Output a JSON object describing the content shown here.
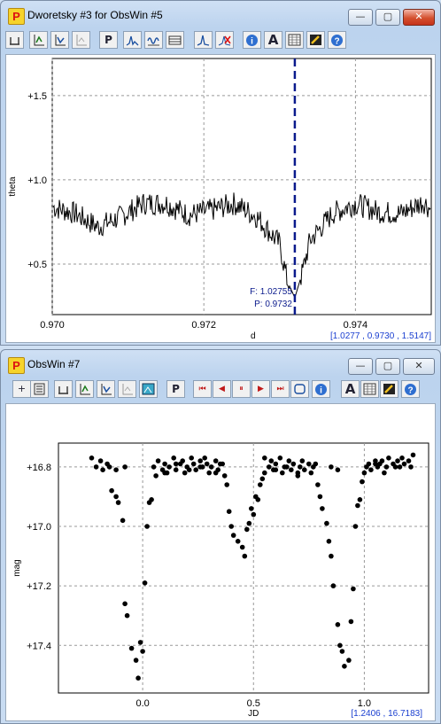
{
  "window1": {
    "title": "Dworetsky #3 for ObsWin #5",
    "app_icon_letter": "P",
    "controls": {
      "minimize": "—",
      "maximize": "▢",
      "close": "✕"
    },
    "toolbar": [
      {
        "icon": "save-icon"
      },
      {
        "icon": "zoom-in-icon"
      },
      {
        "icon": "zoom-out-icon"
      },
      {
        "icon": "zoom-disabled-icon"
      },
      {
        "icon": "period-icon",
        "label": "P"
      },
      {
        "icon": "periodogram-icon"
      },
      {
        "icon": "wave-icon"
      },
      {
        "icon": "table-icon"
      },
      {
        "icon": "peak-icon"
      },
      {
        "icon": "remove-peak-icon"
      },
      {
        "icon": "info-icon"
      },
      {
        "icon": "font-icon",
        "label": "A"
      },
      {
        "icon": "grid-icon"
      },
      {
        "icon": "edit-icon"
      },
      {
        "icon": "help-icon"
      }
    ],
    "status": "[1.0277 , 0.9730 , 1.5147]",
    "annotation_freq": "F: 1.02755",
    "annotation_period": "P: 0.9732",
    "chart_data": {
      "type": "line",
      "xlabel": "d",
      "ylabel": "theta",
      "xlim": [
        0.97,
        0.975
      ],
      "ylim": [
        0.2,
        1.72
      ],
      "xticks": [
        0.97,
        0.972,
        0.974
      ],
      "xtick_labels": [
        "0.970",
        "0.972",
        "0.974"
      ],
      "yticks": [
        0.5,
        1.0,
        1.5
      ],
      "ytick_labels": [
        "+0.5",
        "+1.0",
        "+1.5"
      ],
      "grid": true,
      "marker_line_x": 0.9732,
      "x": [
        0.97,
        0.9703,
        0.9706,
        0.9709,
        0.9712,
        0.9715,
        0.9718,
        0.9721,
        0.9724,
        0.9727,
        0.973,
        0.9731,
        0.9732,
        0.9733,
        0.9734,
        0.9737,
        0.974,
        0.9743,
        0.9746,
        0.9749,
        0.975
      ],
      "y": [
        0.84,
        0.8,
        0.72,
        0.78,
        0.86,
        0.86,
        0.79,
        0.82,
        0.86,
        0.78,
        0.62,
        0.4,
        0.3,
        0.45,
        0.64,
        0.8,
        0.86,
        0.81,
        0.8,
        0.87,
        0.82
      ]
    }
  },
  "window2": {
    "title": "ObsWin #7",
    "app_icon_letter": "P",
    "controls": {
      "minimize": "—",
      "maximize": "▢",
      "close": "✕"
    },
    "toolbar": [
      {
        "icon": "add-icon",
        "label": "+"
      },
      {
        "icon": "calc-icon"
      },
      {
        "icon": "save-icon"
      },
      {
        "icon": "zoom-in-icon"
      },
      {
        "icon": "zoom-out-icon"
      },
      {
        "icon": "zoom-disabled-icon"
      },
      {
        "icon": "image-icon"
      },
      {
        "icon": "period-icon",
        "label": "P"
      },
      {
        "icon": "first-icon",
        "label": "⏮"
      },
      {
        "icon": "prev-icon",
        "label": "◀"
      },
      {
        "icon": "pause-icon",
        "label": "⏸"
      },
      {
        "icon": "next-icon",
        "label": "▶"
      },
      {
        "icon": "last-icon",
        "label": "⏭"
      },
      {
        "icon": "loop-icon"
      },
      {
        "icon": "info-icon"
      },
      {
        "icon": "font-icon",
        "label": "A"
      },
      {
        "icon": "grid-icon"
      },
      {
        "icon": "edit-icon"
      },
      {
        "icon": "help-icon"
      }
    ],
    "status": "[1.2406 , 16.7183]",
    "chart_data": {
      "type": "scatter",
      "xlabel": "JD",
      "ylabel": "mag",
      "xlim": [
        -0.38,
        1.29
      ],
      "ylim": [
        17.56,
        16.72
      ],
      "xticks": [
        0.0,
        0.5,
        1.0
      ],
      "xtick_labels": [
        "0.0",
        "0.5",
        "1.0"
      ],
      "yticks": [
        16.8,
        17.0,
        17.2,
        17.4
      ],
      "ytick_labels": [
        "+16.8",
        "+17.0",
        "+17.2",
        "+17.4"
      ],
      "grid": true,
      "x": [
        -0.23,
        -0.21,
        -0.19,
        -0.18,
        -0.16,
        -0.14,
        -0.12,
        -0.11,
        -0.09,
        -0.08,
        -0.07,
        -0.05,
        -0.03,
        -0.02,
        -0.01,
        0.0,
        0.01,
        0.02,
        0.03,
        0.04,
        0.05,
        0.06,
        0.07,
        0.09,
        0.1,
        0.11,
        0.12,
        0.14,
        0.15,
        0.17,
        0.18,
        0.19,
        0.2,
        0.22,
        0.23,
        0.24,
        0.26,
        0.27,
        0.28,
        0.29,
        0.3,
        0.31,
        0.33,
        0.34,
        0.35,
        0.37,
        0.38,
        0.39,
        0.4,
        0.41,
        0.43,
        0.45,
        0.46,
        0.47,
        0.48,
        0.49,
        0.5,
        0.51,
        0.52,
        0.53,
        0.54,
        0.55,
        0.57,
        0.58,
        0.59,
        0.6,
        0.62,
        0.63,
        0.64,
        0.66,
        0.67,
        0.68,
        0.7,
        0.71,
        0.72,
        0.73,
        0.75,
        0.76,
        0.77,
        0.79,
        0.8,
        0.81,
        0.83,
        0.84,
        0.85,
        0.86,
        0.88,
        0.89,
        0.9,
        0.91,
        0.93,
        0.94,
        0.95,
        0.96,
        0.97,
        0.98,
        0.99,
        1.0,
        1.01,
        1.02,
        1.03,
        1.05,
        1.06,
        1.07,
        1.08,
        1.1,
        1.11,
        1.13,
        1.14,
        1.15,
        1.17,
        1.18,
        1.2,
        1.21,
        1.22,
        -0.15,
        -0.12,
        -0.08,
        0.1,
        0.15,
        0.21,
        0.26,
        0.33,
        0.36,
        0.55,
        0.6,
        0.65,
        0.7,
        0.78,
        0.85,
        0.88,
        1.05,
        1.09,
        1.16
      ],
      "y": [
        16.77,
        16.8,
        16.78,
        16.81,
        16.79,
        16.88,
        16.9,
        16.92,
        16.98,
        17.26,
        17.3,
        17.41,
        17.45,
        17.51,
        17.39,
        17.42,
        17.19,
        17.0,
        16.92,
        16.91,
        16.8,
        16.83,
        16.78,
        16.81,
        16.79,
        16.82,
        16.8,
        16.77,
        16.81,
        16.79,
        16.78,
        16.82,
        16.8,
        16.77,
        16.79,
        16.81,
        16.78,
        16.8,
        16.77,
        16.79,
        16.82,
        16.8,
        16.78,
        16.81,
        16.79,
        16.83,
        16.86,
        16.95,
        17.0,
        17.03,
        17.05,
        17.07,
        17.1,
        17.01,
        16.99,
        16.94,
        16.96,
        16.9,
        16.91,
        16.86,
        16.84,
        16.82,
        16.8,
        16.78,
        16.81,
        16.79,
        16.77,
        16.82,
        16.8,
        16.78,
        16.81,
        16.79,
        16.83,
        16.8,
        16.78,
        16.81,
        16.79,
        16.82,
        16.8,
        16.86,
        16.9,
        16.94,
        16.99,
        17.05,
        17.1,
        17.2,
        17.33,
        17.4,
        17.42,
        17.47,
        17.45,
        17.32,
        17.21,
        17.0,
        16.93,
        16.91,
        16.85,
        16.82,
        16.8,
        16.79,
        16.81,
        16.78,
        16.8,
        16.79,
        16.78,
        16.8,
        16.77,
        16.79,
        16.8,
        16.78,
        16.77,
        16.79,
        16.78,
        16.8,
        16.76,
        16.8,
        16.81,
        16.8,
        16.82,
        16.79,
        16.81,
        16.8,
        16.82,
        16.79,
        16.77,
        16.81,
        16.8,
        16.82,
        16.79,
        16.8,
        16.81,
        16.79,
        16.82,
        16.8
      ]
    }
  }
}
